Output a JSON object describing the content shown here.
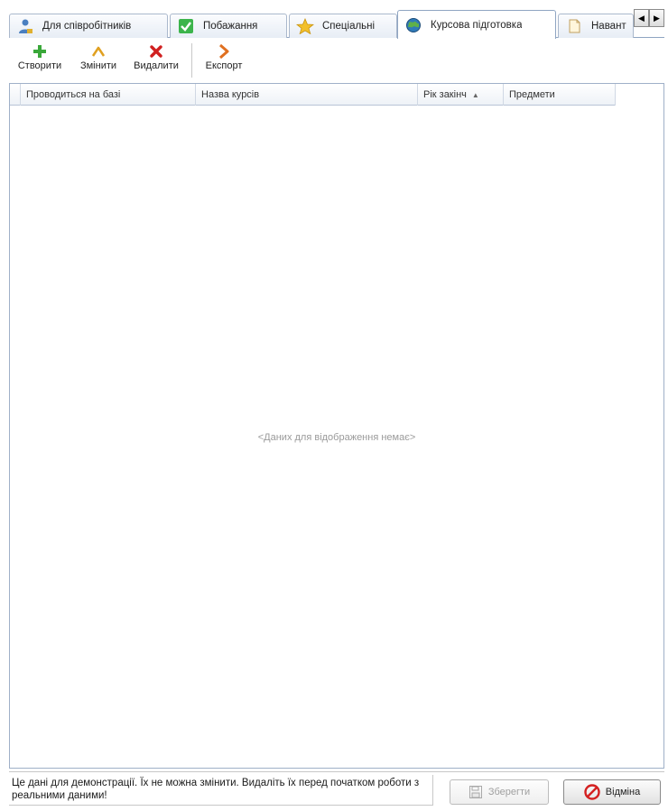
{
  "tabs": [
    {
      "label": "Для співробітників",
      "icon": "user-icon",
      "active": false
    },
    {
      "label": "Побажання",
      "icon": "checkmark-icon",
      "active": false
    },
    {
      "label": "Спеціальні",
      "icon": "star-icon",
      "active": false
    },
    {
      "label": "Курсова підготовка",
      "icon": "globe-icon",
      "active": true
    },
    {
      "label": "Навант",
      "icon": "document-icon",
      "active": false
    }
  ],
  "tab_scroll": {
    "left": "◀",
    "right": "▶"
  },
  "toolbar": {
    "create_label": "Створити",
    "edit_label": "Змінити",
    "delete_label": "Видалити",
    "export_label": "Експорт"
  },
  "grid": {
    "columns": [
      "Проводиться на базі",
      "Назва курсів",
      "Рік закінч",
      "Предмети"
    ],
    "sorted_column": "Рік закінч",
    "sort_direction": "ascending",
    "empty_text": "<Даних для відображення немає>",
    "rows": []
  },
  "footer": {
    "note": "Це дані для демонстрації. Їх не можна змінити. Видаліть їх перед початком роботи з реальними даними!",
    "save_label": "Зберегти",
    "cancel_label": "Відміна"
  },
  "colors": {
    "accent": "#8fa5c2",
    "create": "#3aa83a",
    "delete": "#d02020",
    "export": "#e07020",
    "cancel": "#d42020"
  }
}
